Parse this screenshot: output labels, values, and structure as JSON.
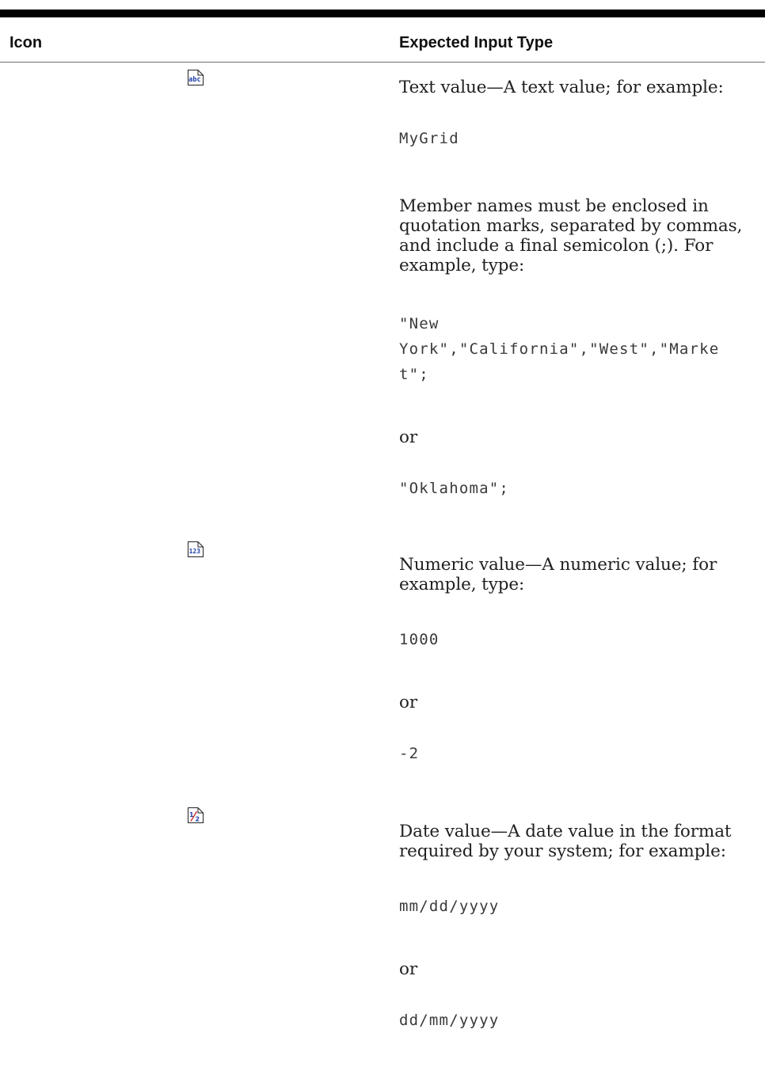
{
  "table": {
    "headers": {
      "icon": "Icon",
      "expected_input_type": "Expected Input Type"
    },
    "rows": [
      {
        "icon": "abc-text-icon",
        "description": "Text value—A text value; for example:",
        "example_1": "MyGrid",
        "note": "Member names must be enclosed in quotation marks, separated by commas, and include a final semicolon (;). For example, type:",
        "example_2_line_1": "\"New",
        "example_2_line_2": "York\",\"California\",\"West\",\"Marke",
        "example_2_line_3": "t\";",
        "or": "or",
        "example_3": "\"Oklahoma\";"
      },
      {
        "icon": "123-numeric-icon",
        "description": "Numeric value—A numeric value; for example, type:",
        "example_1": "1000",
        "or": "or",
        "example_2": "-2"
      },
      {
        "icon": "fraction-date-icon",
        "description": "Date value—A date value in the format required by your system; for example:",
        "example_1": "mm/dd/yyyy",
        "or": "or",
        "example_2": "dd/mm/yyyy"
      }
    ]
  },
  "colors": {
    "rule": "#000000",
    "icon_blue": "#1f3ea8",
    "icon_red": "#c62828"
  }
}
